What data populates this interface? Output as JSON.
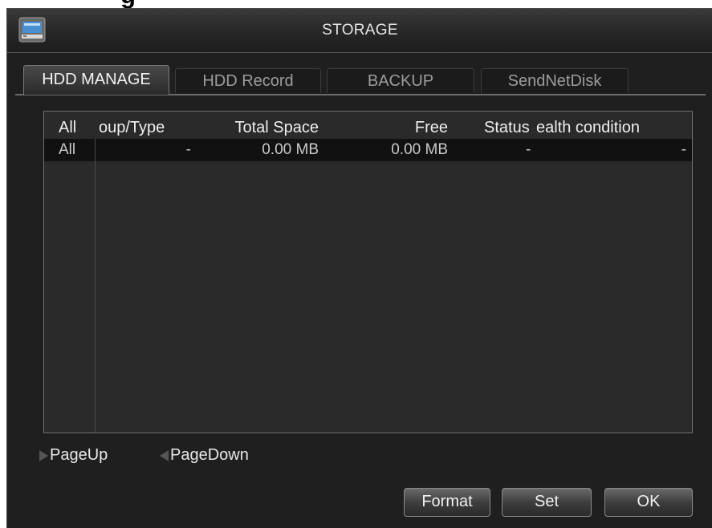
{
  "page_heading_fragment": "g",
  "window": {
    "title": "STORAGE",
    "icon": "monitor-icon"
  },
  "tabs": [
    {
      "label": "HDD MANAGE",
      "active": true
    },
    {
      "label": "HDD Record",
      "active": false
    },
    {
      "label": "BACKUP",
      "active": false
    },
    {
      "label": "SendNetDisk",
      "active": false
    }
  ],
  "table": {
    "headers": [
      "All",
      "oup/Type",
      "Total Space",
      "Free",
      "Status",
      "ealth condition"
    ],
    "rows": [
      {
        "all": "All",
        "group_type": "-",
        "total_space": "0.00 MB",
        "free": "0.00 MB",
        "status": "-",
        "health": "-"
      }
    ]
  },
  "pager": {
    "page_up": "PageUp",
    "page_down": "PageDown"
  },
  "buttons": {
    "format": "Format",
    "set": "Set",
    "ok": "OK"
  },
  "colors": {
    "window_bg": "#1f1f1f",
    "table_bg": "#2a2a2a",
    "row_bg": "#111111",
    "text": "#e6e6e6"
  }
}
